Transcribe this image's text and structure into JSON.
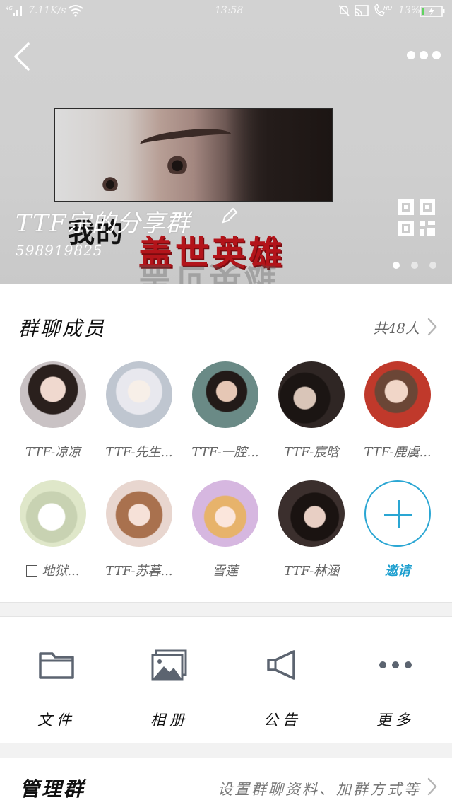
{
  "status_bar": {
    "speed": "7.11K/s",
    "time": "13:58",
    "battery": "13%",
    "battery_level": 0.13,
    "icons": [
      "signal-icon",
      "wifi-icon",
      "mute-icon",
      "cast-icon",
      "hd-call-icon",
      "battery-icon"
    ]
  },
  "header": {
    "back_icon": "back-arrow-icon",
    "more_icon": "more-dots-icon"
  },
  "banner": {
    "group_name": "TTF宗的分享群",
    "group_id": "598919825",
    "image_text_line1": "我的",
    "image_text_line2": "盖世英雄",
    "image_text_reflection": "盖世英雄",
    "qr_icon": "qr-code-icon",
    "page_count": 3,
    "active_page": 1
  },
  "members": {
    "title": "群聊成员",
    "count_label": "共48人",
    "items": [
      {
        "name": "TTF-凉凉",
        "color": "#c9c2c4"
      },
      {
        "name": "TTF-先生...",
        "color": "#e6e6ea"
      },
      {
        "name": "TTF-一腔...",
        "color": "#6a8a86"
      },
      {
        "name": "TTF-宸晗",
        "color": "#2f2624"
      },
      {
        "name": "TTF-鹿虞...",
        "color": "#c0392b"
      },
      {
        "name": "地狱...",
        "color": "#dfe7c9"
      },
      {
        "name": "TTF-苏暮...",
        "color": "#e8d6cf"
      },
      {
        "name": "雪莲",
        "color": "#d6b7e0"
      },
      {
        "name": "TTF-林涵",
        "color": "#3b2f2d"
      }
    ],
    "invite_label": "邀请"
  },
  "tools": [
    {
      "label": "文件",
      "icon": "folder-icon"
    },
    {
      "label": "相册",
      "icon": "album-icon"
    },
    {
      "label": "公告",
      "icon": "megaphone-icon"
    },
    {
      "label": "更多",
      "icon": "more-dots-icon"
    }
  ],
  "manage": {
    "title": "管理群",
    "description": "设置群聊资料、加群方式等"
  },
  "colors": {
    "accent": "#2aa6d3",
    "icon_gray": "#5c6470",
    "banner_bg": "#cfcfcf"
  }
}
